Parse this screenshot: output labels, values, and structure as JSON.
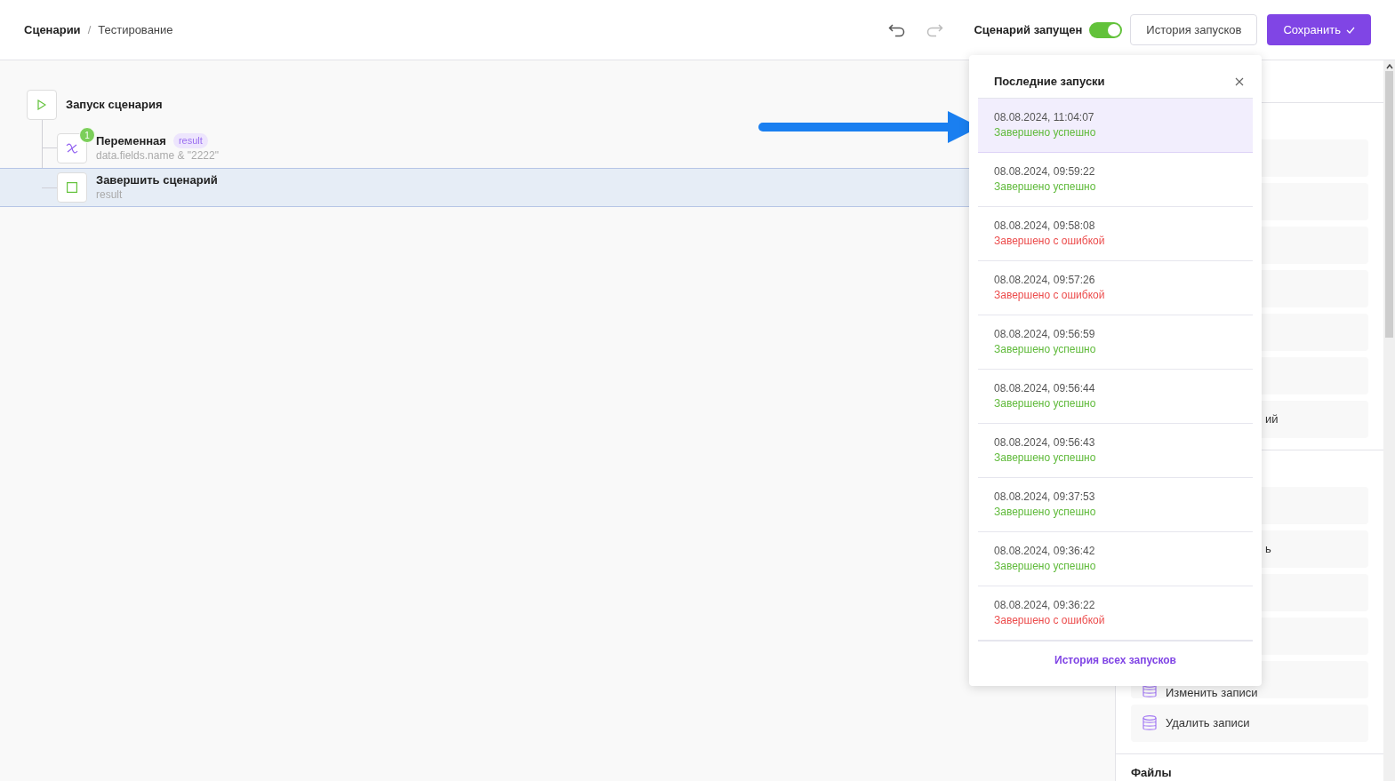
{
  "breadcrumb": {
    "items": [
      {
        "label": "Сценарии"
      },
      {
        "label": "Тестирование"
      }
    ],
    "separator": "/"
  },
  "toolbar": {
    "running_label": "Сценарий запущен",
    "running": true,
    "history_button": "История запусков",
    "save_button": "Сохранить"
  },
  "flow": {
    "start": {
      "title": "Запуск сценария"
    },
    "children": [
      {
        "kind": "variable",
        "title": "Переменная",
        "tag": "result",
        "subtitle": "data.fields.name & \"2222\"",
        "badge": "1",
        "selected": false
      },
      {
        "kind": "end",
        "title": "Завершить сценарий",
        "subtitle": "result",
        "selected": true
      }
    ]
  },
  "runs_popup": {
    "title": "Последние запуски",
    "runs": [
      {
        "time": "08.08.2024, 11:04:07",
        "status": "Завершено успешно",
        "kind": "success",
        "selected": true
      },
      {
        "time": "08.08.2024, 09:59:22",
        "status": "Завершено успешно",
        "kind": "success",
        "selected": false
      },
      {
        "time": "08.08.2024, 09:58:08",
        "status": "Завершено с ошибкой",
        "kind": "error",
        "selected": false
      },
      {
        "time": "08.08.2024, 09:57:26",
        "status": "Завершено с ошибкой",
        "kind": "error",
        "selected": false
      },
      {
        "time": "08.08.2024, 09:56:59",
        "status": "Завершено успешно",
        "kind": "success",
        "selected": false
      },
      {
        "time": "08.08.2024, 09:56:44",
        "status": "Завершено успешно",
        "kind": "success",
        "selected": false
      },
      {
        "time": "08.08.2024, 09:56:43",
        "status": "Завершено успешно",
        "kind": "success",
        "selected": false
      },
      {
        "time": "08.08.2024, 09:37:53",
        "status": "Завершено успешно",
        "kind": "success",
        "selected": false
      },
      {
        "time": "08.08.2024, 09:36:42",
        "status": "Завершено успешно",
        "kind": "success",
        "selected": false
      },
      {
        "time": "08.08.2024, 09:36:22",
        "status": "Завершено с ошибкой",
        "kind": "error",
        "selected": false
      }
    ],
    "footer_link": "История всех запусков"
  },
  "side_panel": {
    "sections": [
      {
        "items": [
          {
            "kind": "blank"
          },
          {
            "kind": "blank"
          },
          {
            "kind": "blank"
          },
          {
            "kind": "blank"
          },
          {
            "kind": "blank"
          },
          {
            "kind": "blank"
          },
          {
            "kind": "partial",
            "label": "ий"
          }
        ]
      },
      {
        "items": [
          {
            "kind": "blank"
          },
          {
            "kind": "partial",
            "label": "ь"
          },
          {
            "kind": "blank"
          },
          {
            "kind": "blank"
          },
          {
            "kind": "database",
            "label": "Изменить записи"
          },
          {
            "kind": "database",
            "label": "Удалить записи"
          }
        ]
      }
    ],
    "next_heading": "Файлы"
  }
}
